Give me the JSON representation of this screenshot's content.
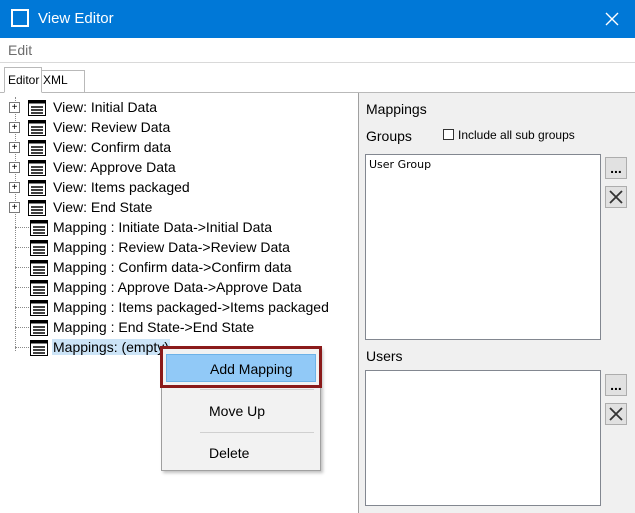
{
  "window": {
    "title": "View Editor"
  },
  "menubar": {
    "items": [
      "Edit"
    ]
  },
  "tabs": {
    "editor": "Editor",
    "xml": "XML"
  },
  "tree": {
    "views": [
      "View: Initial Data",
      "View: Review Data",
      "View: Confirm data",
      "View: Approve Data",
      "View: Items packaged",
      "View: End State"
    ],
    "mappings": [
      "Mapping : Initiate Data->Initial Data",
      "Mapping : Review Data->Review Data",
      "Mapping : Confirm data->Confirm data",
      "Mapping : Approve Data->Approve Data",
      "Mapping : Items packaged->Items packaged",
      "Mapping : End State->End State"
    ],
    "selected": "Mappings: (empty)"
  },
  "context_menu": {
    "items": [
      "Add Mapping",
      "Move Up",
      "Delete"
    ],
    "highlighted": "Add Mapping"
  },
  "right_panel": {
    "heading": "Mappings",
    "groups_label": "Groups",
    "include_sub_groups_label": "Include all sub groups",
    "include_sub_groups_checked": false,
    "groups_list": [
      "User Group"
    ],
    "users_label": "Users",
    "users_list": [],
    "browse_button": "...",
    "clear_icon": "close-x-icon"
  },
  "colors": {
    "titlebar": "#0078d7",
    "selection": "#cce4f7",
    "menu_highlight": "#91c9f7",
    "annotation_box": "#8b1a1a"
  }
}
